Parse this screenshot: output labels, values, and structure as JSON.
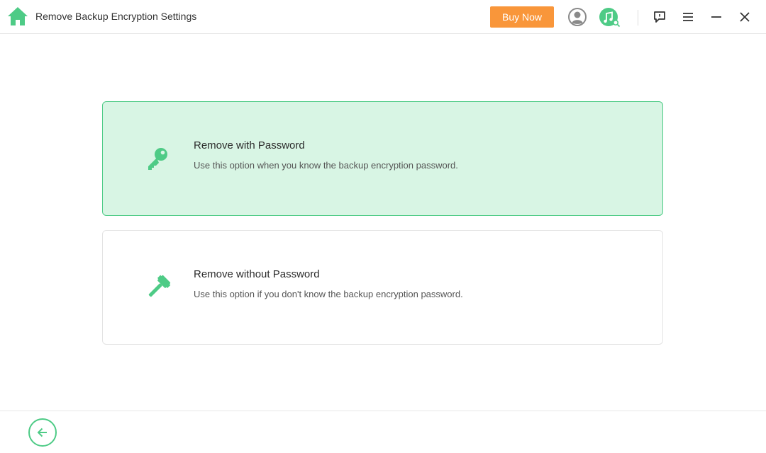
{
  "titlebar": {
    "title": "Remove Backup Encryption Settings",
    "buy_now_label": "Buy Now",
    "icons": [
      "home-icon",
      "user-icon",
      "music-search-icon",
      "feedback-icon",
      "menu-icon",
      "minimize-icon",
      "close-icon"
    ]
  },
  "options": [
    {
      "title": "Remove with Password",
      "description": "Use this option when you know the backup encryption password.",
      "icon": "key-icon",
      "selected": true
    },
    {
      "title": "Remove without Password",
      "description": "Use this option if you don't know the backup encryption password.",
      "icon": "hammer-icon",
      "selected": false
    }
  ],
  "footer": {
    "back_icon": "back-arrow-icon"
  },
  "colors": {
    "accent_green": "#4ecb86",
    "selected_card_bg": "#d8f5e4",
    "buy_now_orange": "#f9963a"
  }
}
